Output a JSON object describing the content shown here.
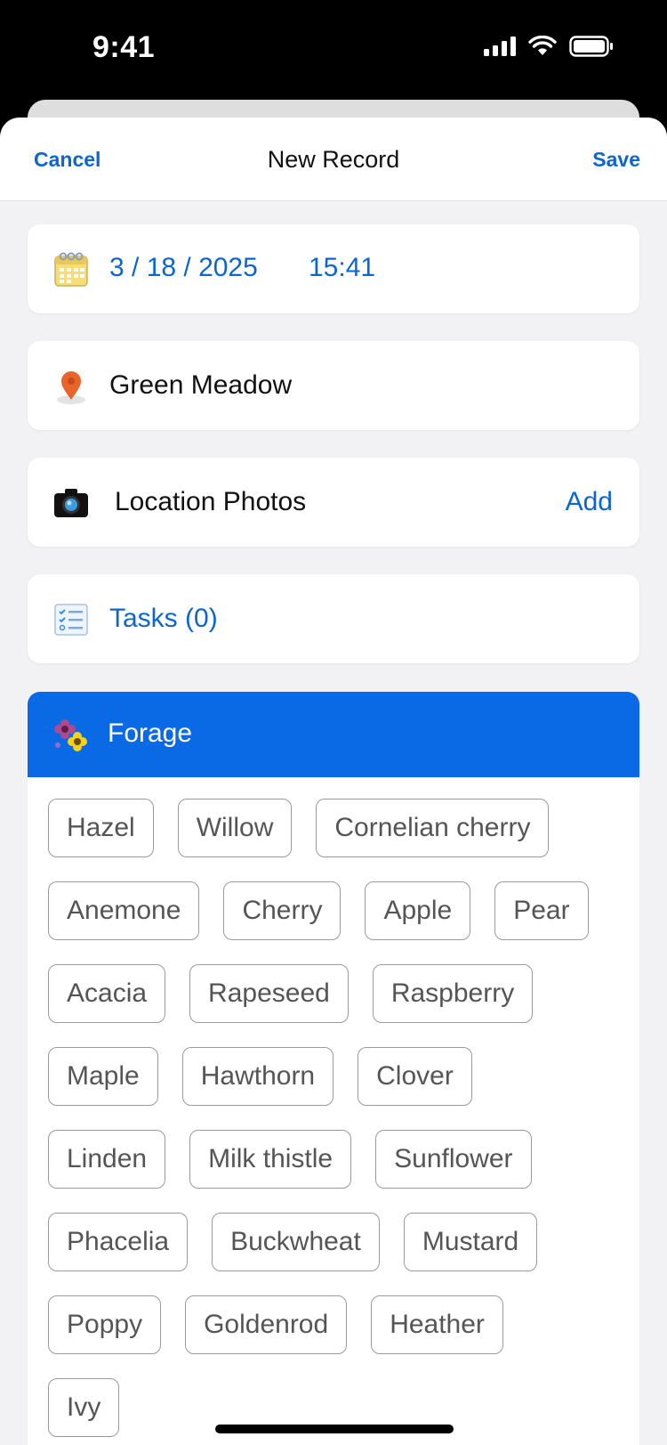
{
  "status": {
    "time": "9:41"
  },
  "nav": {
    "cancel": "Cancel",
    "title": "New Record",
    "save": "Save"
  },
  "date": {
    "date": "3 / 18 / 2025",
    "time": "15:41",
    "icon": "calendar-icon"
  },
  "location": {
    "name": "Green Meadow",
    "icon": "map-pin-icon"
  },
  "photos": {
    "label": "Location Photos",
    "action": "Add",
    "icon": "camera-icon"
  },
  "tasks": {
    "label": "Tasks (0)",
    "icon": "checklist-icon"
  },
  "forage": {
    "title": "Forage",
    "icon": "flowers-icon",
    "header_color": "#0a6ae6",
    "rows": [
      [
        "Hazel",
        "Willow",
        "Cornelian cherry"
      ],
      [
        "Anemone",
        "Cherry",
        "Apple",
        "Pear"
      ],
      [
        "Acacia",
        "Rapeseed",
        "Raspberry"
      ],
      [
        "Maple",
        "Hawthorn",
        "Clover"
      ],
      [
        "Linden",
        "Milk thistle",
        "Sunflower"
      ],
      [
        "Phacelia",
        "Buckwheat",
        "Mustard"
      ],
      [
        "Poppy",
        "Goldenrod",
        "Heather"
      ],
      [
        "Ivy"
      ]
    ]
  },
  "colors": {
    "accent": "#0b66cf",
    "background": "#f2f2f4"
  }
}
